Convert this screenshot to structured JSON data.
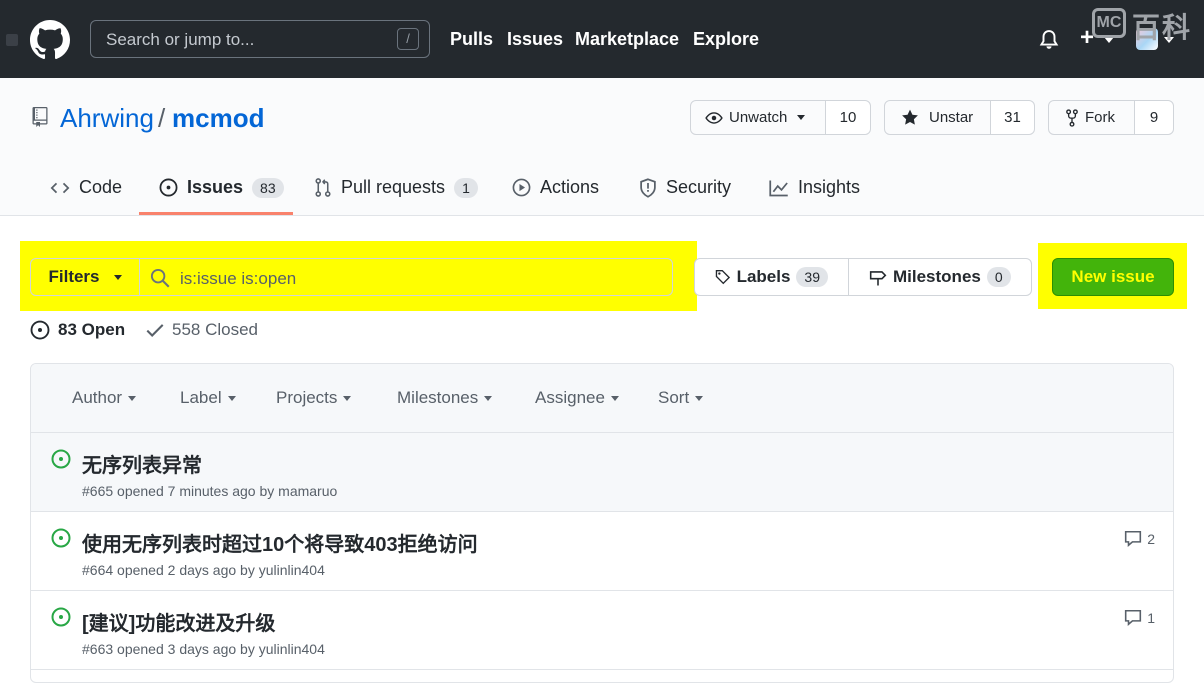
{
  "header": {
    "search_placeholder": "Search or jump to...",
    "search_shortcut": "/",
    "nav": [
      "Pulls",
      "Issues",
      "Marketplace",
      "Explore"
    ],
    "watermark_mc": "MC",
    "watermark_text": "百科"
  },
  "repo": {
    "owner": "Ahrwing",
    "separator": "/",
    "name": "mcmod",
    "watch_label": "Unwatch",
    "watch_count": "10",
    "star_label": "Unstar",
    "star_count": "31",
    "fork_label": "Fork",
    "fork_count": "9"
  },
  "tabs": {
    "code": "Code",
    "issues": "Issues",
    "issues_count": "83",
    "pulls": "Pull requests",
    "pulls_count": "1",
    "actions": "Actions",
    "security": "Security",
    "insights": "Insights"
  },
  "subnav": {
    "filters_label": "Filters",
    "query": "is:issue is:open",
    "labels_label": "Labels",
    "labels_count": "39",
    "milestones_label": "Milestones",
    "milestones_count": "0",
    "new_issue_label": "New issue"
  },
  "states": {
    "open": "83 Open",
    "closed": "558 Closed"
  },
  "table_header": {
    "author": "Author",
    "label": "Label",
    "projects": "Projects",
    "milestones": "Milestones",
    "assignee": "Assignee",
    "sort": "Sort"
  },
  "issues": [
    {
      "title": "无序列表异常",
      "meta": "#665 opened 7 minutes ago by mamaruo",
      "comments": ""
    },
    {
      "title": "使用无序列表时超过10个将导致403拒绝访问",
      "meta": "#664 opened 2 days ago by yulinlin404",
      "comments": "2"
    },
    {
      "title": "[建议]功能改进及升级",
      "meta": "#663 opened 3 days ago by yulinlin404",
      "comments": "1"
    }
  ],
  "colors": {
    "header_bg": "#24292e",
    "link": "#0366d6",
    "open_green": "#28a745",
    "highlight": "#ffff00",
    "new_issue_bg": "#43b40b",
    "tab_underline": "#f9826c"
  }
}
